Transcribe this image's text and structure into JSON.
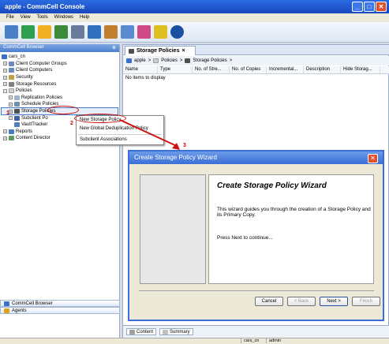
{
  "window": {
    "title": "apple - CommCell Console"
  },
  "menu": [
    "File",
    "View",
    "Tools",
    "Windows",
    "Help"
  ],
  "left_panel": {
    "title": "CommCell Browser",
    "tree": [
      {
        "label": "cars_cn",
        "level": 0
      },
      {
        "label": "Client Computer Groups",
        "level": 1
      },
      {
        "label": "Client Computers",
        "level": 1
      },
      {
        "label": "Security",
        "level": 1
      },
      {
        "label": "Storage Resources",
        "level": 1
      },
      {
        "label": "Policies",
        "level": 1
      },
      {
        "label": "Replication Policies",
        "level": 2
      },
      {
        "label": "Schedule Policies",
        "level": 2
      },
      {
        "label": "Storage Policies",
        "level": 2
      },
      {
        "label": "Subclient Po",
        "level": 2
      },
      {
        "label": "VaultTracker",
        "level": 2
      },
      {
        "label": "Reports",
        "level": 1
      },
      {
        "label": "Content Director",
        "level": 1
      }
    ],
    "bottom_items": [
      "CommCell Browser",
      "Agents"
    ]
  },
  "context_menu": {
    "items": [
      "New Storage Policy",
      "New Global Deduplication Policy",
      "Subclient Associations"
    ]
  },
  "callouts": [
    "1",
    "2",
    "3"
  ],
  "main": {
    "tab_label": "Storage Policies",
    "breadcrumb": [
      "apple",
      "Policies",
      "Storage Policies"
    ],
    "columns": [
      "Name",
      "Type",
      "No. of Stre...",
      "No. of Copies",
      "Incremental...",
      "Description",
      "Hide Storag..."
    ],
    "empty_text": "No items to display",
    "bottom_tabs": [
      "Content",
      "Summary"
    ]
  },
  "dialog": {
    "title": "Create Storage Policy Wizard",
    "heading": "Create Storage Policy Wizard",
    "text1": "This wizard guides you through the creation of a Storage Policy and its Primary Copy.",
    "text2": "Press Next to continue...",
    "buttons": {
      "cancel": "Cancel",
      "back": "< Back",
      "next": "Next >",
      "finish": "Finish"
    }
  },
  "status": {
    "user_context": "cars_cn",
    "user": "admin"
  },
  "colors": {
    "accent": "#3a6fd6",
    "callout": "#cc0000"
  }
}
